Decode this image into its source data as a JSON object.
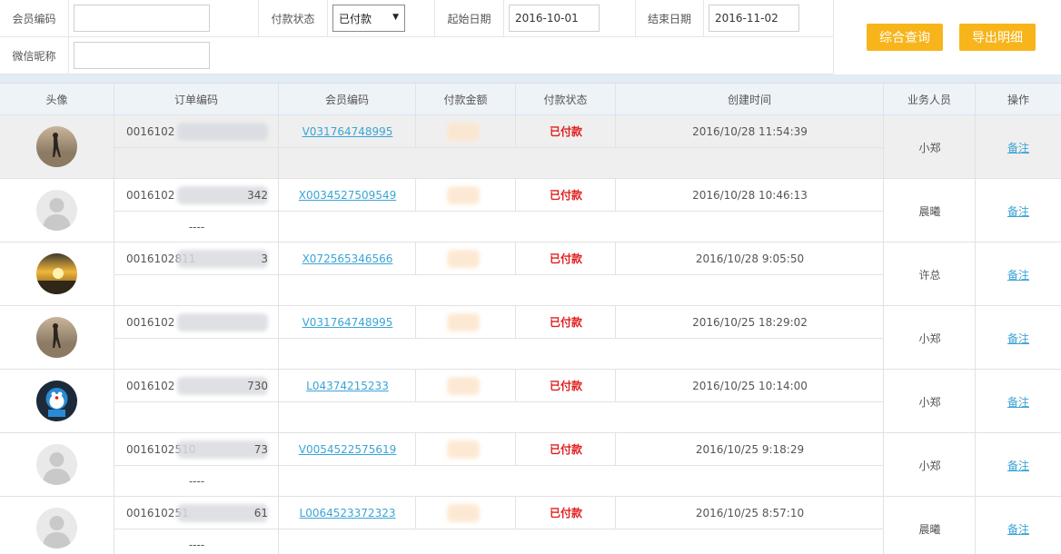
{
  "filters": {
    "member_code_label": "会员编码",
    "member_code_value": "",
    "pay_status_label": "付款状态",
    "pay_status_value": "已付款",
    "start_date_label": "起始日期",
    "start_date_value": "2016-10-01",
    "end_date_label": "结束日期",
    "end_date_value": "2016-11-02",
    "wechat_label": "微信昵称",
    "wechat_value": "",
    "search_button": "综合查询",
    "export_button": "导出明细"
  },
  "table": {
    "headers": [
      "头像",
      "订单编码",
      "会员编码",
      "付款金额",
      "付款状态",
      "创建时间",
      "业务人员",
      "操作"
    ],
    "rows": [
      {
        "order_prefix": "0016102",
        "order_suffix": "",
        "order_sub": "",
        "member": "V031764748995",
        "status": "已付款",
        "created": "2016/10/28 11:54:39",
        "staff": "小郑",
        "action": "备注",
        "avatar": "photo-couple",
        "highlight": true
      },
      {
        "order_prefix": "0016102",
        "order_suffix": "342",
        "order_sub": "----",
        "member": "X0034527509549",
        "status": "已付款",
        "created": "2016/10/28 10:46:13",
        "staff": "晨曦",
        "action": "备注",
        "avatar": "default",
        "highlight": false
      },
      {
        "order_prefix": "0016102811",
        "order_suffix": "3",
        "order_sub": "",
        "member": "X072565346566",
        "status": "已付款",
        "created": "2016/10/28 9:05:50",
        "staff": "许总",
        "action": "备注",
        "avatar": "photo-sunset",
        "highlight": false
      },
      {
        "order_prefix": "0016102",
        "order_suffix": "",
        "order_sub": "",
        "member": "V031764748995",
        "status": "已付款",
        "created": "2016/10/25 18:29:02",
        "staff": "小郑",
        "action": "备注",
        "avatar": "photo-couple",
        "highlight": false
      },
      {
        "order_prefix": "0016102",
        "order_suffix": "730",
        "order_sub": "",
        "member": "L04374215233",
        "status": "已付款",
        "created": "2016/10/25 10:14:00",
        "staff": "小郑",
        "action": "备注",
        "avatar": "photo-doraemon",
        "highlight": false
      },
      {
        "order_prefix": "0016102510",
        "order_suffix": "73",
        "order_sub": "----",
        "member": "V0054522575619",
        "status": "已付款",
        "created": "2016/10/25 9:18:29",
        "staff": "小郑",
        "action": "备注",
        "avatar": "default",
        "highlight": false
      },
      {
        "order_prefix": "001610251",
        "order_suffix": "61",
        "order_sub": "----",
        "member": "L0064523372323",
        "status": "已付款",
        "created": "2016/10/25 8:57:10",
        "staff": "晨曦",
        "action": "备注",
        "avatar": "default",
        "highlight": false
      }
    ]
  },
  "colors": {
    "accent_button": "#f7b51b",
    "link": "#3ba4d6",
    "status_paid": "#e02020",
    "header_band": "#e3ebf3"
  }
}
